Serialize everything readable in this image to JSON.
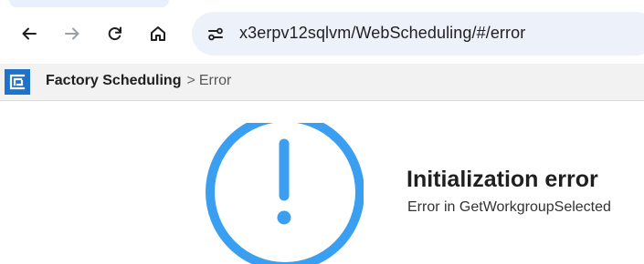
{
  "browser": {
    "url": "x3erpv12sqlvm/WebScheduling/#/error",
    "icons": {
      "back": "back-arrow-icon",
      "forward": "forward-arrow-icon",
      "reload": "reload-icon",
      "home": "home-icon",
      "site_info": "site-settings-icon"
    }
  },
  "app": {
    "breadcrumb": {
      "app_name": "Factory Scheduling",
      "separator": ">",
      "current": "Error"
    },
    "logo_icon": "factory-scheduling-logo"
  },
  "error": {
    "icon": "exclamation-circle-icon",
    "title": "Initialization error",
    "message": "Error in GetWorkgroupSelected"
  },
  "colors": {
    "accent": "#3a9ff0",
    "logo": "#1e73c8",
    "omnibox_bg": "#edf2fa",
    "header_bg": "#f2f2f2"
  }
}
